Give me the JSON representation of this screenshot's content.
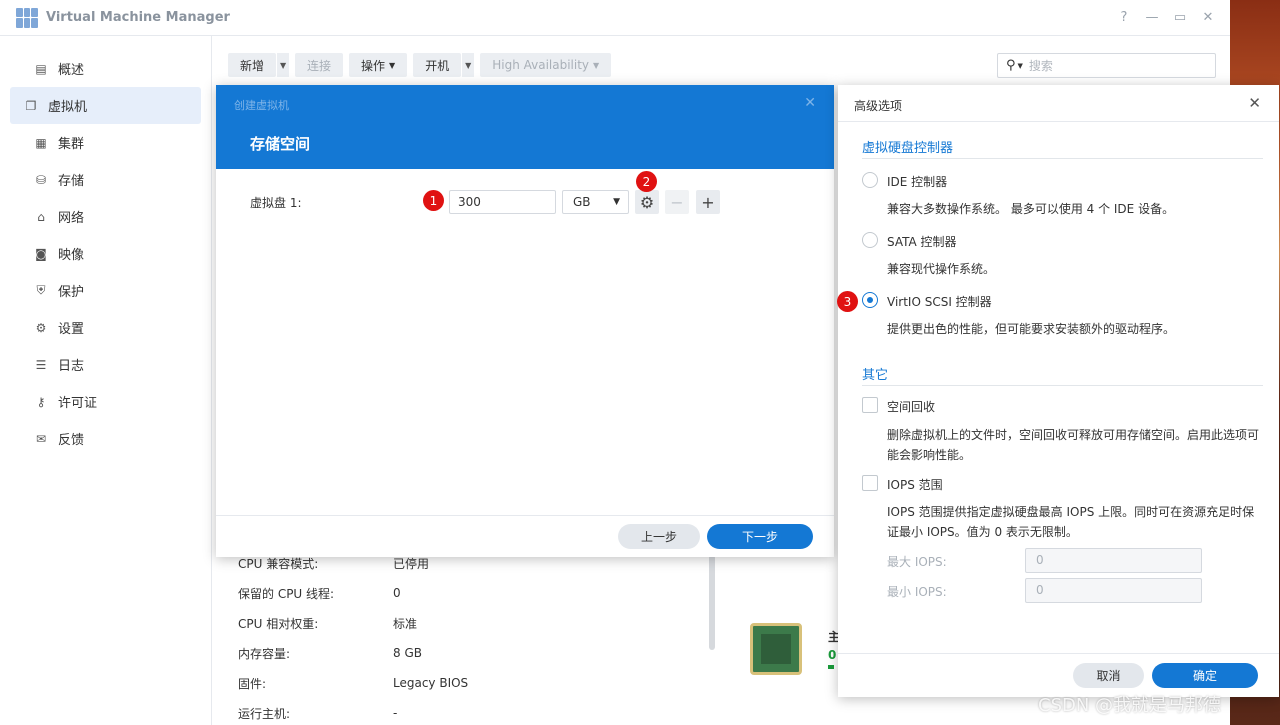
{
  "window": {
    "title": "Virtual Machine Manager",
    "controls": [
      "?",
      "—",
      "▭",
      "✕"
    ]
  },
  "sidebar": {
    "items": [
      {
        "label": "概述",
        "icon": "overview-icon"
      },
      {
        "label": "虚拟机",
        "icon": "vm-icon",
        "active": true
      },
      {
        "label": "集群",
        "icon": "cluster-icon"
      },
      {
        "label": "存储",
        "icon": "storage-icon"
      },
      {
        "label": "网络",
        "icon": "network-icon"
      },
      {
        "label": "映像",
        "icon": "image-icon"
      },
      {
        "label": "保护",
        "icon": "shield-icon"
      },
      {
        "label": "设置",
        "icon": "gear-icon"
      },
      {
        "label": "日志",
        "icon": "log-icon"
      },
      {
        "label": "许可证",
        "icon": "key-icon"
      },
      {
        "label": "反馈",
        "icon": "mail-icon"
      }
    ]
  },
  "toolbar": {
    "new": "新增",
    "connect": "连接",
    "action": "操作",
    "power_on": "开机",
    "ha": "High Availability",
    "search_placeholder": "搜索"
  },
  "details": {
    "rows": [
      {
        "key": "CPU 兼容模式:",
        "value": "已停用"
      },
      {
        "key": "保留的 CPU 线程:",
        "value": "0"
      },
      {
        "key": "CPU 相对权重:",
        "value": "标准"
      },
      {
        "key": "内存容量:",
        "value": "8 GB"
      },
      {
        "key": "固件:",
        "value": "Legacy BIOS"
      },
      {
        "key": "运行主机:",
        "value": "-"
      }
    ],
    "host_label": "主",
    "host_value": "0"
  },
  "create_dialog": {
    "subtitle": "创建虚拟机",
    "title": "存储空间",
    "disk_label": "虚拟盘 1:",
    "disk_size": "300",
    "disk_unit": "GB",
    "back": "上一步",
    "next": "下一步"
  },
  "advanced": {
    "title": "高级选项",
    "controller_section": "虚拟硬盘控制器",
    "ide_label": "IDE 控制器",
    "ide_desc": "兼容大多数操作系统。 最多可以使用 4 个 IDE 设备。",
    "sata_label": "SATA 控制器",
    "sata_desc": "兼容现代操作系统。",
    "virtio_label": "VirtIO SCSI 控制器",
    "virtio_desc": "提供更出色的性能，但可能要求安装额外的驱动程序。",
    "selected": "VirtIO SCSI 控制器",
    "other_section": "其它",
    "reclaim_label": "空间回收",
    "reclaim_desc": "删除虚拟机上的文件时，空间回收可释放可用存储空间。启用此选项可能会影响性能。",
    "iops_label": "IOPS 范围",
    "iops_desc": "IOPS 范围提供指定虚拟硬盘最高 IOPS 上限。同时可在资源充足时保证最小 IOPS。值为 0 表示无限制。",
    "max_iops_label": "最大 IOPS:",
    "max_iops_value": "0",
    "min_iops_label": "最小 IOPS:",
    "min_iops_value": "0",
    "cancel": "取消",
    "ok": "确定"
  },
  "badges": {
    "one": "1",
    "two": "2",
    "three": "3"
  },
  "watermark": "CSDN @我就是马邦德",
  "colors": {
    "accent": "#1478d4",
    "badge": "#e01212"
  }
}
